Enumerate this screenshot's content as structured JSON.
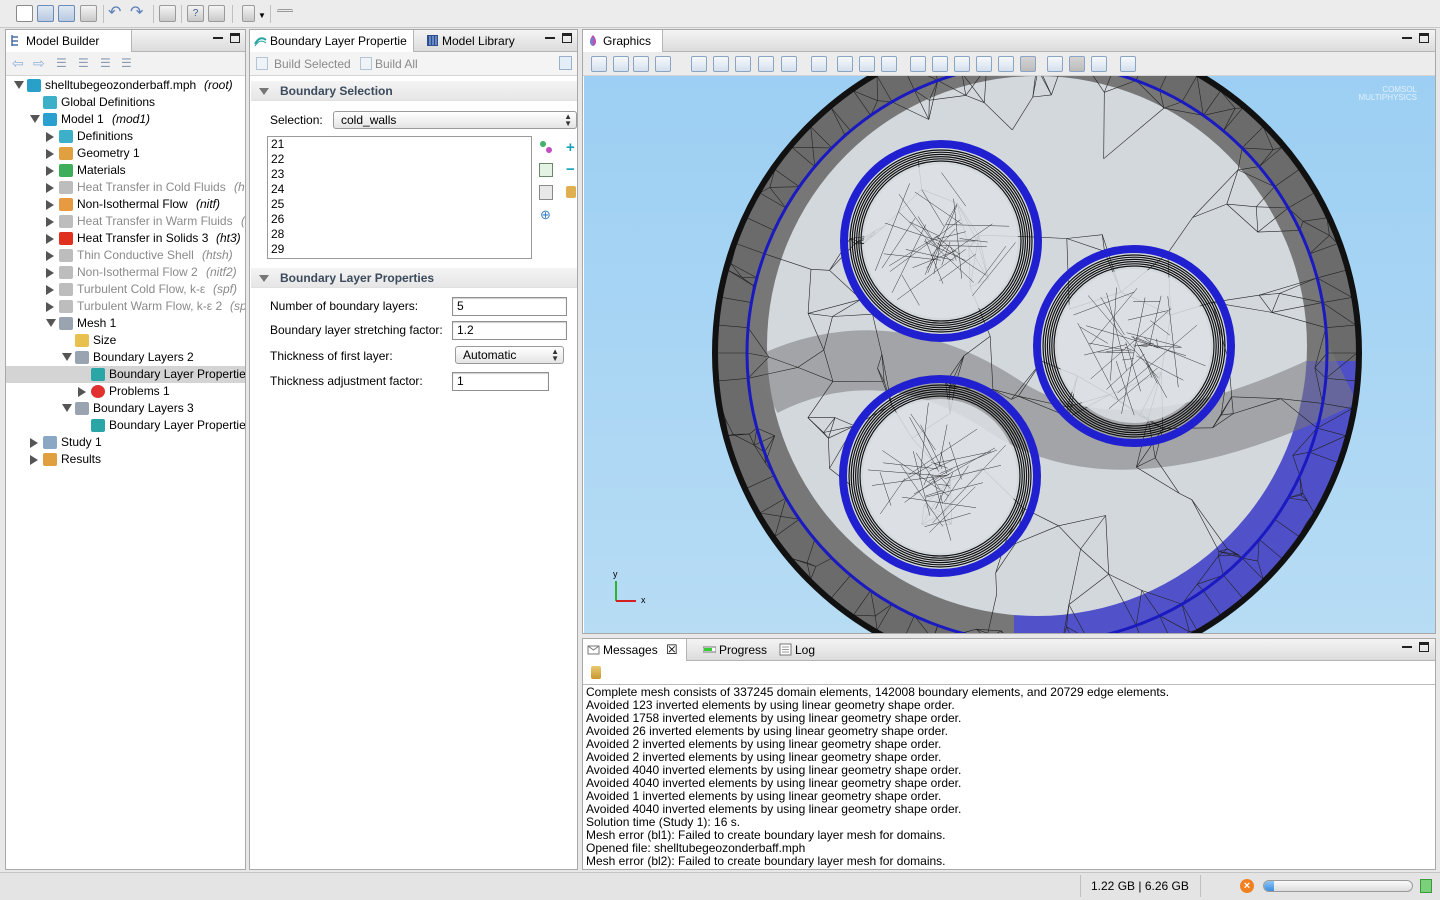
{
  "model_builder": {
    "tab_label": "Model Builder",
    "tree": [
      {
        "label": "shelltubegeozonderbaff.mph",
        "suffix": "(root)",
        "dim": false
      },
      {
        "label": "Global Definitions",
        "suffix": "",
        "dim": false
      },
      {
        "label": "Model 1",
        "suffix": "(mod1)",
        "dim": false
      },
      {
        "label": "Definitions",
        "suffix": "",
        "dim": false
      },
      {
        "label": "Geometry 1",
        "suffix": "",
        "dim": false
      },
      {
        "label": "Materials",
        "suffix": "",
        "dim": false
      },
      {
        "label": "Heat Transfer in Cold Fluids",
        "suffix": "(ht",
        "dim": true
      },
      {
        "label": "Non-Isothermal Flow",
        "suffix": "(nitf)",
        "dim": false
      },
      {
        "label": "Heat Transfer in Warm Fluids",
        "suffix": "(h",
        "dim": true
      },
      {
        "label": "Heat Transfer in Solids 3",
        "suffix": "(ht3)",
        "dim": false
      },
      {
        "label": "Thin Conductive Shell",
        "suffix": "(htsh)",
        "dim": true
      },
      {
        "label": "Non-Isothermal Flow 2",
        "suffix": "(nitf2)",
        "dim": true
      },
      {
        "label": "Turbulent Cold Flow, k-ε",
        "suffix": "(spf)",
        "dim": true
      },
      {
        "label": "Turbulent Warm Flow, k-ε 2",
        "suffix": "(sp",
        "dim": true
      },
      {
        "label": "Mesh 1",
        "suffix": "",
        "dim": false
      },
      {
        "label": "Size",
        "suffix": "",
        "dim": false
      },
      {
        "label": "Boundary Layers 2",
        "suffix": "",
        "dim": false
      },
      {
        "label": "Boundary Layer Propertie:",
        "suffix": "",
        "dim": false
      },
      {
        "label": "Problems 1",
        "suffix": "",
        "dim": false
      },
      {
        "label": "Boundary Layers 3",
        "suffix": "",
        "dim": false
      },
      {
        "label": "Boundary Layer Propertie:",
        "suffix": "",
        "dim": false
      },
      {
        "label": "Study 1",
        "suffix": "",
        "dim": false
      },
      {
        "label": "Results",
        "suffix": "",
        "dim": false
      }
    ]
  },
  "settings": {
    "tab_label": "Boundary Layer Propertie",
    "library_tab_label": "Model Library",
    "build_selected": "Build Selected",
    "build_all": "Build All",
    "section_selection": "Boundary Selection",
    "selection_label": "Selection:",
    "selection_value": "cold_walls",
    "boundaries": [
      "21",
      "22",
      "23",
      "24",
      "25",
      "26",
      "28",
      "29"
    ],
    "section_props": "Boundary Layer Properties",
    "num_layers_label": "Number of boundary layers:",
    "num_layers_value": "5",
    "stretch_label": "Boundary layer stretching factor:",
    "stretch_value": "1.2",
    "first_layer_label": "Thickness of first layer:",
    "first_layer_value": "Automatic",
    "adjust_label": "Thickness adjustment factor:",
    "adjust_value": "1"
  },
  "graphics": {
    "tab_label": "Graphics",
    "watermark": "COMSOL MULTIPHYSICS",
    "axis_y": "y",
    "axis_x": "x",
    "colors": {
      "background": "#a8d4f2",
      "mesh_dark": "#6e6e6e",
      "mesh_light": "#d9dde2",
      "boundary": "#2525d6"
    }
  },
  "messages": {
    "tab_messages": "Messages",
    "tab_progress": "Progress",
    "tab_log": "Log",
    "lines": [
      "Complete mesh consists of 337245 domain elements, 142008 boundary elements, and 20729 edge elements.",
      "Avoided 123 inverted elements by using linear geometry shape order.",
      "Avoided 1758 inverted elements by using linear geometry shape order.",
      "Avoided 26 inverted elements by using linear geometry shape order.",
      "Avoided 2 inverted elements by using linear geometry shape order.",
      "Avoided 2 inverted elements by using linear geometry shape order.",
      "Avoided 4040 inverted elements by using linear geometry shape order.",
      "Avoided 4040 inverted elements by using linear geometry shape order.",
      "Avoided 1 inverted elements by using linear geometry shape order.",
      "Avoided 4040 inverted elements by using linear geometry shape order.",
      "Solution time (Study 1): 16 s.",
      "Mesh error (bl1): Failed to create boundary layer mesh for domains.",
      "Opened file: shelltubegeozonderbaff.mph",
      "Mesh error (bl2): Failed to create boundary layer mesh for domains."
    ]
  },
  "status": {
    "memory": "1.22 GB | 6.26 GB",
    "progress_fraction": 0.07
  }
}
